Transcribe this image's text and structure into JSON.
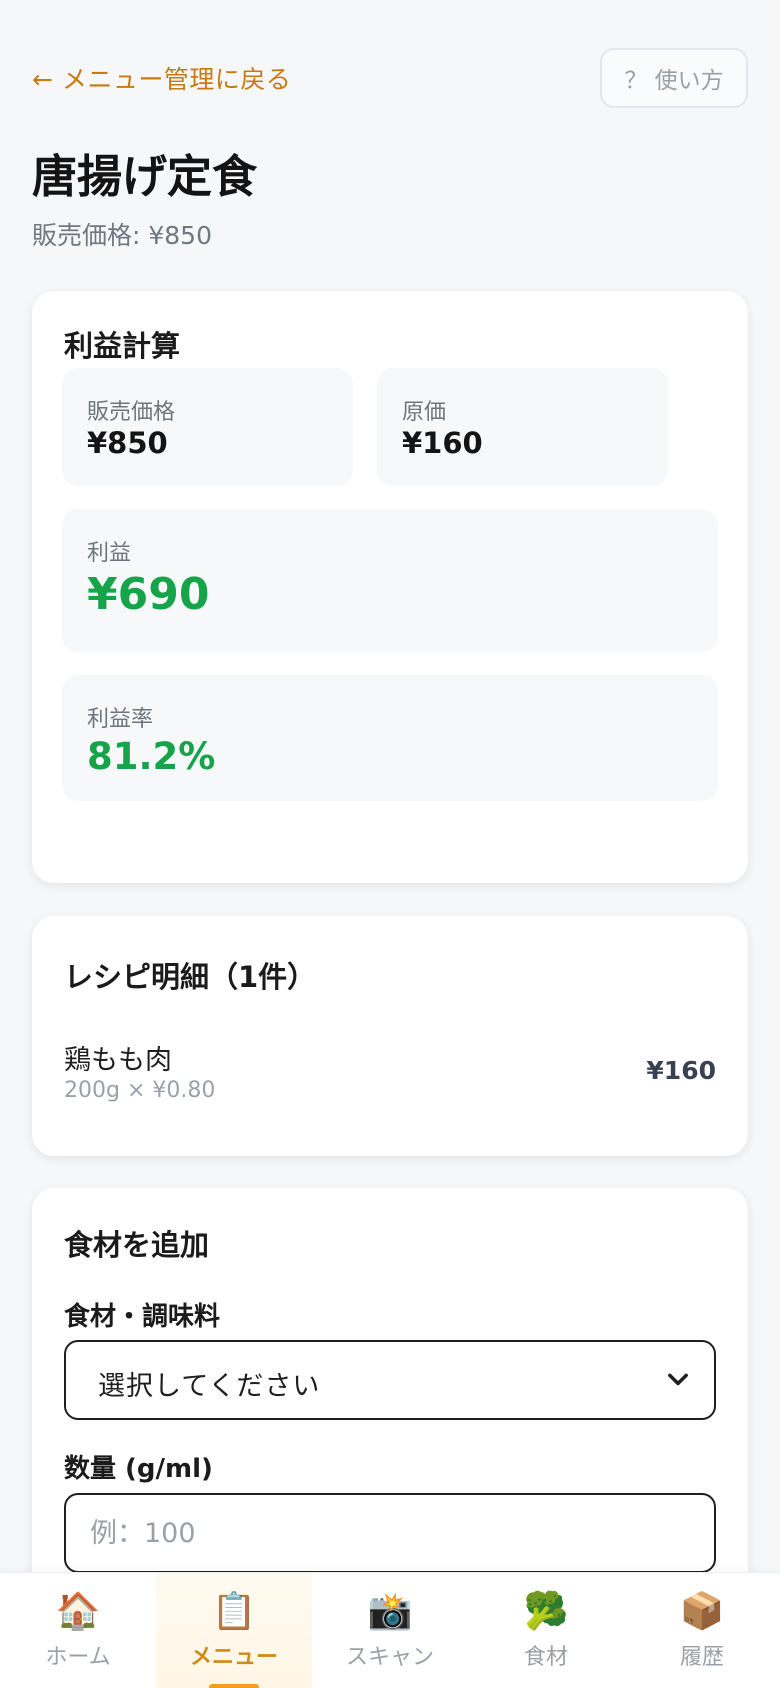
{
  "header": {
    "back_label": "← メニュー管理に戻る",
    "help_label": "？ 使い方"
  },
  "menu": {
    "title": "唐揚げ定食",
    "subtitle": "販売価格: ¥850"
  },
  "profit": {
    "heading": "利益計算",
    "sale_price_label": "販売価格",
    "sale_price_value": "¥850",
    "cost_label": "原価",
    "cost_value": "¥160",
    "profit_label": "利益",
    "profit_value": "¥690",
    "margin_label": "利益率",
    "margin_value": "81.2%",
    "accent_color": "#16a34a"
  },
  "recipe": {
    "heading": "レシピ明細（1件）",
    "items": [
      {
        "name": "鶏もも肉",
        "detail": "200g × ¥0.80",
        "price": "¥160"
      }
    ]
  },
  "add_ingredient": {
    "heading": "食材を追加",
    "ingredient_label": "食材・調味料",
    "ingredient_selected": "選択してください",
    "quantity_label": "数量 (g/ml)",
    "quantity_placeholder": "例：100",
    "quantity_value": ""
  },
  "nav": {
    "items": [
      {
        "label": "ホーム",
        "icon": "house-icon",
        "glyph": "🏠"
      },
      {
        "label": "メニュー",
        "icon": "clipboard-icon",
        "glyph": "📋"
      },
      {
        "label": "スキャン",
        "icon": "camera-flash-icon",
        "glyph": "📸"
      },
      {
        "label": "食材",
        "icon": "broccoli-icon",
        "glyph": "🥦"
      },
      {
        "label": "履歴",
        "icon": "package-icon",
        "glyph": "📦"
      }
    ],
    "active_color": "#d18a14"
  }
}
